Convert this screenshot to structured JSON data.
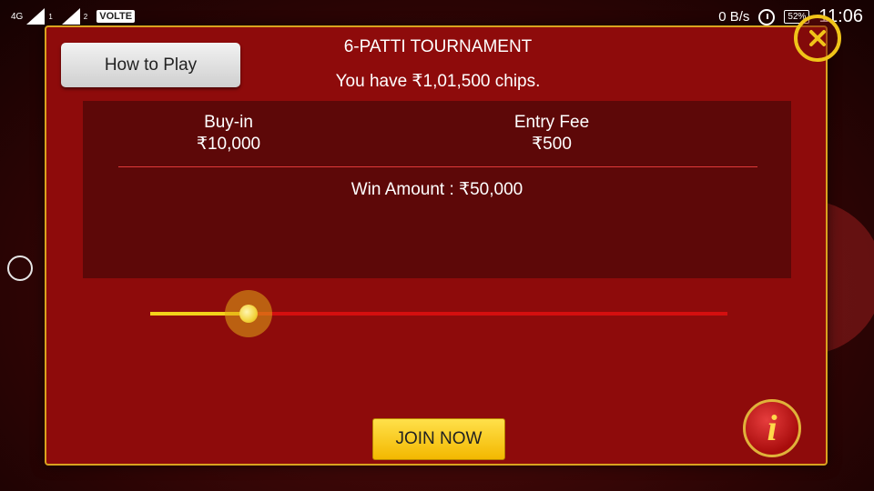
{
  "status_bar": {
    "network": "4G",
    "sim1": "1",
    "sim2": "2",
    "volte": "VOLTE",
    "data_speed": "0 B/s",
    "battery": "52%",
    "time": "11:06"
  },
  "dialog": {
    "how_to_play": "How to Play",
    "title": "6-PATTI TOURNAMENT",
    "chips_info": "You have ₹1,01,500 chips.",
    "buy_in": {
      "label": "Buy-in",
      "value": "₹10,000"
    },
    "entry_fee": {
      "label": "Entry Fee",
      "value": "₹500"
    },
    "win_amount": "Win Amount :  ₹50,000",
    "slider_fraction": 0.17,
    "join_label": "JOIN NOW",
    "info_glyph": "i"
  },
  "icons": {
    "close": "close-icon",
    "info": "info-icon",
    "alarm": "alarm-icon"
  },
  "colors": {
    "dialog_bg": "#8e0b0b",
    "dialog_border": "#d9a21f",
    "join_button": "#f3b800",
    "slider_active": "#f3d21a",
    "slider_track": "#d40f0f"
  }
}
